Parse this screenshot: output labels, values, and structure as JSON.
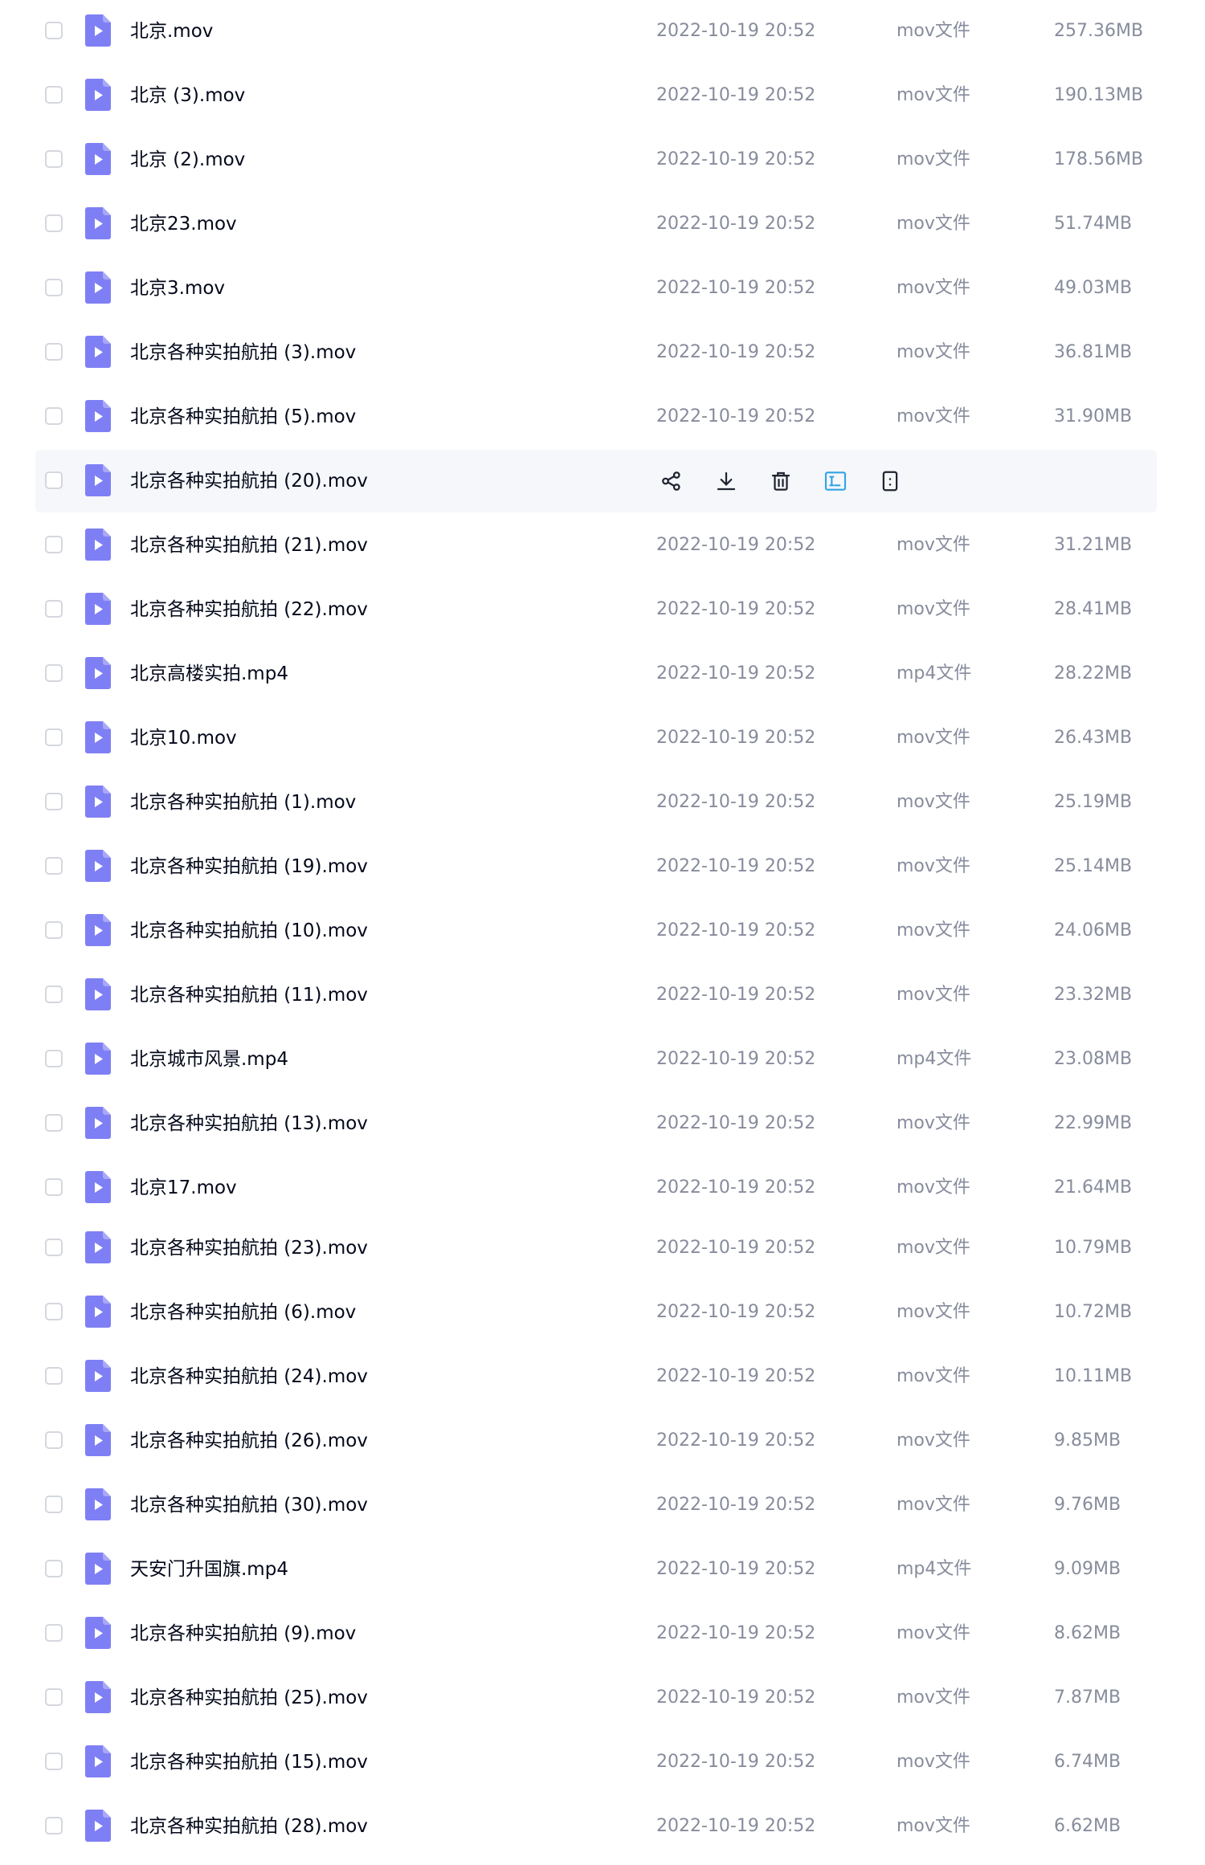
{
  "accent_color": "#7f7ff5",
  "file_type_icon": "video-file-icon",
  "files": [
    {
      "name": "北京.mov",
      "date": "2022-10-19 20:52",
      "type": "mov文件",
      "size": "257.36MB"
    },
    {
      "name": "北京 (3).mov",
      "date": "2022-10-19 20:52",
      "type": "mov文件",
      "size": "190.13MB"
    },
    {
      "name": "北京 (2).mov",
      "date": "2022-10-19 20:52",
      "type": "mov文件",
      "size": "178.56MB"
    },
    {
      "name": "北京23.mov",
      "date": "2022-10-19 20:52",
      "type": "mov文件",
      "size": "51.74MB"
    },
    {
      "name": "北京3.mov",
      "date": "2022-10-19 20:52",
      "type": "mov文件",
      "size": "49.03MB"
    },
    {
      "name": "北京各种实拍航拍 (3).mov",
      "date": "2022-10-19 20:52",
      "type": "mov文件",
      "size": "36.81MB"
    },
    {
      "name": "北京各种实拍航拍 (5).mov",
      "date": "2022-10-19 20:52",
      "type": "mov文件",
      "size": "31.90MB"
    },
    {
      "name": "北京各种实拍航拍 (20).mov",
      "hovered": true,
      "actions": [
        "share-icon",
        "download-icon",
        "trash-icon",
        "rename-icon",
        "more-icon"
      ]
    },
    {
      "name": "北京各种实拍航拍 (21).mov",
      "date": "2022-10-19 20:52",
      "type": "mov文件",
      "size": "31.21MB"
    },
    {
      "name": "北京各种实拍航拍 (22).mov",
      "date": "2022-10-19 20:52",
      "type": "mov文件",
      "size": "28.41MB"
    },
    {
      "name": "北京高楼实拍.mp4",
      "date": "2022-10-19 20:52",
      "type": "mp4文件",
      "size": "28.22MB"
    },
    {
      "name": "北京10.mov",
      "date": "2022-10-19 20:52",
      "type": "mov文件",
      "size": "26.43MB"
    },
    {
      "name": "北京各种实拍航拍 (1).mov",
      "date": "2022-10-19 20:52",
      "type": "mov文件",
      "size": "25.19MB"
    },
    {
      "name": "北京各种实拍航拍 (19).mov",
      "date": "2022-10-19 20:52",
      "type": "mov文件",
      "size": "25.14MB"
    },
    {
      "name": "北京各种实拍航拍 (10).mov",
      "date": "2022-10-19 20:52",
      "type": "mov文件",
      "size": "24.06MB"
    },
    {
      "name": "北京各种实拍航拍 (11).mov",
      "date": "2022-10-19 20:52",
      "type": "mov文件",
      "size": "23.32MB"
    },
    {
      "name": "北京城市风景.mp4",
      "date": "2022-10-19 20:52",
      "type": "mp4文件",
      "size": "23.08MB"
    },
    {
      "name": "北京各种实拍航拍 (13).mov",
      "date": "2022-10-19 20:52",
      "type": "mov文件",
      "size": "22.99MB"
    },
    {
      "name": "北京17.mov",
      "date": "2022-10-19 20:52",
      "type": "mov文件",
      "size": "21.64MB"
    },
    {
      "name": "北京各种实拍航拍 (23).mov",
      "date": "2022-10-19 20:52",
      "type": "mov文件",
      "size": "10.79MB"
    },
    {
      "name": "北京各种实拍航拍 (6).mov",
      "date": "2022-10-19 20:52",
      "type": "mov文件",
      "size": "10.72MB"
    },
    {
      "name": "北京各种实拍航拍 (24).mov",
      "date": "2022-10-19 20:52",
      "type": "mov文件",
      "size": "10.11MB"
    },
    {
      "name": "北京各种实拍航拍 (26).mov",
      "date": "2022-10-19 20:52",
      "type": "mov文件",
      "size": "9.85MB"
    },
    {
      "name": "北京各种实拍航拍 (30).mov",
      "date": "2022-10-19 20:52",
      "type": "mov文件",
      "size": "9.76MB"
    },
    {
      "name": "天安门升国旗.mp4",
      "date": "2022-10-19 20:52",
      "type": "mp4文件",
      "size": "9.09MB"
    },
    {
      "name": "北京各种实拍航拍 (9).mov",
      "date": "2022-10-19 20:52",
      "type": "mov文件",
      "size": "8.62MB"
    },
    {
      "name": "北京各种实拍航拍 (25).mov",
      "date": "2022-10-19 20:52",
      "type": "mov文件",
      "size": "7.87MB"
    },
    {
      "name": "北京各种实拍航拍 (15).mov",
      "date": "2022-10-19 20:52",
      "type": "mov文件",
      "size": "6.74MB"
    },
    {
      "name": "北京各种实拍航拍 (28).mov",
      "date": "2022-10-19 20:52",
      "type": "mov文件",
      "size": "6.62MB"
    }
  ]
}
